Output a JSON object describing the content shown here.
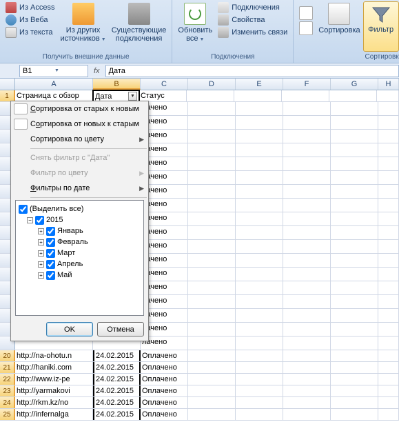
{
  "ribbon": {
    "group1": {
      "access": "Из Access",
      "web": "Из Веба",
      "text": "Из текста",
      "other_l1": "Из других",
      "other_l2": "источников",
      "exist_l1": "Существующие",
      "exist_l2": "подключения",
      "title": "Получить внешние данные"
    },
    "group2": {
      "refresh_l1": "Обновить",
      "refresh_l2": "все",
      "connections": "Подключения",
      "properties": "Свойства",
      "editlinks": "Изменить связи",
      "title": "Подключения"
    },
    "group3": {
      "sort_l1": "Сортировка",
      "filter": "Фильтр",
      "title": "Сортировк"
    }
  },
  "namebox": "B1",
  "formula": "Дата",
  "columns": [
    "A",
    "B",
    "C",
    "D",
    "E",
    "F",
    "G",
    "H"
  ],
  "header_row": {
    "A": "Страница с обзор",
    "B": "Дата",
    "C": "Статус"
  },
  "status_text": "лачено",
  "bottom_rows": [
    {
      "n": 20,
      "url": "http://na-ohotu.n",
      "date": "24.02.2015",
      "status": "Оплачено"
    },
    {
      "n": 21,
      "url": "http://haniki.com",
      "date": "24.02.2015",
      "status": "Оплачено"
    },
    {
      "n": 22,
      "url": "http://www.iz-pe",
      "date": "24.02.2015",
      "status": "Оплачено"
    },
    {
      "n": 23,
      "url": "http://yarmakovi",
      "date": "24.02.2015",
      "status": "Оплачено"
    },
    {
      "n": 24,
      "url": "http://rkm.kz/no",
      "date": "24.02.2015",
      "status": "Оплачено"
    },
    {
      "n": 25,
      "url": "http://infernalga",
      "date": "24.02.2015",
      "status": "Оплачено"
    }
  ],
  "menu": {
    "sort_asc": "Сортировка от старых к новым",
    "sort_desc": "Сортировка от новых к старым",
    "sort_color": "Сортировка по цвету",
    "clear_filter": "Снять фильтр с \"Дата\"",
    "filter_color": "Фильтр по цвету",
    "filter_date": "Фильтры по дате",
    "tree": {
      "all": "(Выделить все)",
      "year": "2015",
      "months": [
        "Январь",
        "Февраль",
        "Март",
        "Апрель",
        "Май"
      ]
    },
    "ok": "OK",
    "cancel": "Отмена"
  }
}
